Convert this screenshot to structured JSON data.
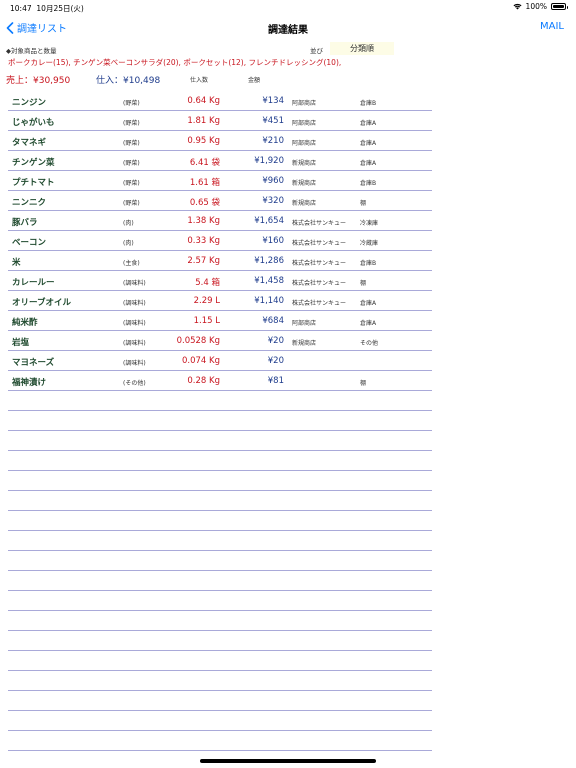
{
  "status_bar": {
    "time": "10:47",
    "date": "10月25日(火)",
    "battery_percent": "100%"
  },
  "nav": {
    "back_label": "調達リスト",
    "title": "調達結果",
    "mail_label": "MAIL"
  },
  "info": {
    "target_label": "◆対象商品と数量",
    "sort_label": "並び",
    "sort_value": "分類順",
    "products_text": "ポークカレー(15), チンゲン菜ベーコンサラダ(20), ポークセット(12), フレンチドレッシング(10),",
    "sales": "売上：¥30,950",
    "purchase": "仕入：¥10,498",
    "header_qty": "仕入数",
    "header_amount": "金額"
  },
  "items": [
    {
      "name": "ニンジン",
      "category": "(野菜)",
      "qty": "0.64 Kg",
      "amount": "¥134",
      "supplier": "阿部商店",
      "location": "倉庫B"
    },
    {
      "name": "じゃがいも",
      "category": "(野菜)",
      "qty": "1.81 Kg",
      "amount": "¥451",
      "supplier": "阿部商店",
      "location": "倉庫A"
    },
    {
      "name": "タマネギ",
      "category": "(野菜)",
      "qty": "0.95 Kg",
      "amount": "¥210",
      "supplier": "阿部商店",
      "location": "倉庫A"
    },
    {
      "name": "チンゲン菜",
      "category": "(野菜)",
      "qty": "6.41 袋",
      "amount": "¥1,920",
      "supplier": "新規商店",
      "location": "倉庫A"
    },
    {
      "name": "プチトマト",
      "category": "(野菜)",
      "qty": "1.61 箱",
      "amount": "¥960",
      "supplier": "新規商店",
      "location": "倉庫B"
    },
    {
      "name": "ニンニク",
      "category": "(野菜)",
      "qty": "0.65 袋",
      "amount": "¥320",
      "supplier": "新規商店",
      "location": "棚"
    },
    {
      "name": "豚バラ",
      "category": "(肉)",
      "qty": "1.38 Kg",
      "amount": "¥1,654",
      "supplier": "株式会社サンキュー",
      "location": "冷凍庫"
    },
    {
      "name": "ベーコン",
      "category": "(肉)",
      "qty": "0.33 Kg",
      "amount": "¥160",
      "supplier": "株式会社サンキュー",
      "location": "冷蔵庫"
    },
    {
      "name": "米",
      "category": "(主食)",
      "qty": "2.57 Kg",
      "amount": "¥1,286",
      "supplier": "株式会社サンキュー",
      "location": "倉庫B"
    },
    {
      "name": "カレールー",
      "category": "(調味料)",
      "qty": "5.4 箱",
      "amount": "¥1,458",
      "supplier": "株式会社サンキュー",
      "location": "棚"
    },
    {
      "name": "オリーブオイル",
      "category": "(調味料)",
      "qty": "2.29 L",
      "amount": "¥1,140",
      "supplier": "株式会社サンキュー",
      "location": "倉庫A"
    },
    {
      "name": "純米酢",
      "category": "(調味料)",
      "qty": "1.15 L",
      "amount": "¥684",
      "supplier": "阿部商店",
      "location": "倉庫A"
    },
    {
      "name": "岩塩",
      "category": "(調味料)",
      "qty": "0.0528 Kg",
      "amount": "¥20",
      "supplier": "新規商店",
      "location": "その他"
    },
    {
      "name": "マヨネーズ",
      "category": "(調味料)",
      "qty": "0.074 Kg",
      "amount": "¥20",
      "supplier": "",
      "location": ""
    },
    {
      "name": "福神漬け",
      "category": "(その他)",
      "qty": "0.28 Kg",
      "amount": "¥81",
      "supplier": "",
      "location": "棚"
    }
  ],
  "empty_row_count": 18
}
